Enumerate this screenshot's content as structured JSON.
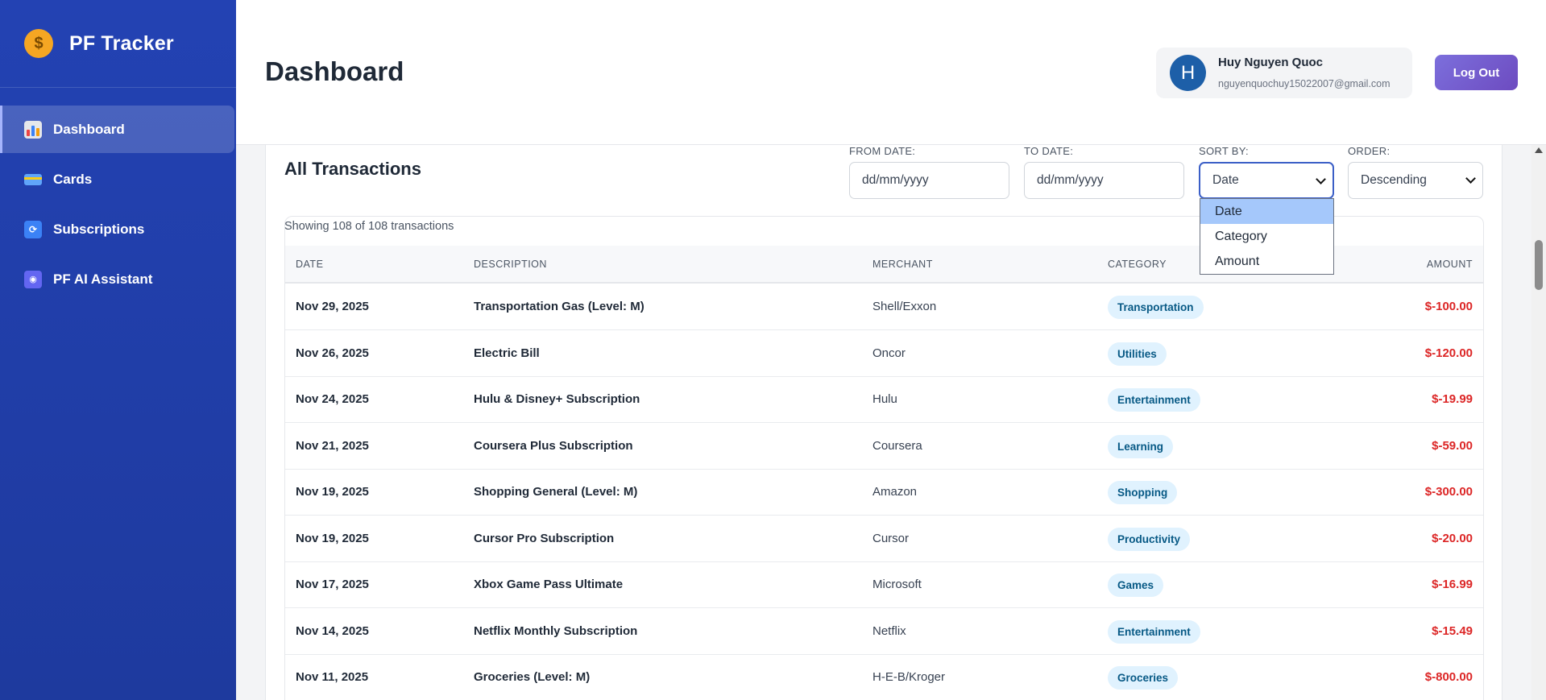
{
  "sidebar": {
    "brand_title": "PF Tracker",
    "items": [
      {
        "label": "Dashboard",
        "icon": "chart-icon",
        "active": true
      },
      {
        "label": "Cards",
        "icon": "credit-card-icon",
        "active": false
      },
      {
        "label": "Subscriptions",
        "icon": "refresh-icon",
        "active": false
      },
      {
        "label": "PF AI Assistant",
        "icon": "robot-icon",
        "active": false
      }
    ]
  },
  "header": {
    "title": "Dashboard",
    "user": {
      "initial": "H",
      "name": "Huy Nguyen Quoc",
      "email": "nguyenquochuy15022007@gmail.com"
    },
    "logout_label": "Log Out"
  },
  "transactions": {
    "title": "All Transactions",
    "filters": {
      "from_label": "FROM DATE:",
      "from_placeholder": "dd/mm/yyyy",
      "to_label": "TO DATE:",
      "to_placeholder": "dd/mm/yyyy",
      "sort_label": "SORT BY:",
      "sort_value": "Date",
      "sort_options": [
        "Date",
        "Category",
        "Amount"
      ],
      "order_label": "ORDER:",
      "order_value": "Descending"
    },
    "showing_text": "Showing 108 of 108 transactions",
    "columns": [
      "DATE",
      "DESCRIPTION",
      "MERCHANT",
      "CATEGORY",
      "AMOUNT"
    ],
    "rows": [
      {
        "date": "Nov 29, 2025",
        "description": "Transportation Gas (Level: M)",
        "merchant": "Shell/Exxon",
        "category": "Transportation",
        "amount": "$-100.00"
      },
      {
        "date": "Nov 26, 2025",
        "description": "Electric Bill",
        "merchant": "Oncor",
        "category": "Utilities",
        "amount": "$-120.00"
      },
      {
        "date": "Nov 24, 2025",
        "description": "Hulu & Disney+ Subscription",
        "merchant": "Hulu",
        "category": "Entertainment",
        "amount": "$-19.99"
      },
      {
        "date": "Nov 21, 2025",
        "description": "Coursera Plus Subscription",
        "merchant": "Coursera",
        "category": "Learning",
        "amount": "$-59.00"
      },
      {
        "date": "Nov 19, 2025",
        "description": "Shopping General (Level: M)",
        "merchant": "Amazon",
        "category": "Shopping",
        "amount": "$-300.00"
      },
      {
        "date": "Nov 19, 2025",
        "description": "Cursor Pro Subscription",
        "merchant": "Cursor",
        "category": "Productivity",
        "amount": "$-20.00"
      },
      {
        "date": "Nov 17, 2025",
        "description": "Xbox Game Pass Ultimate",
        "merchant": "Microsoft",
        "category": "Games",
        "amount": "$-16.99"
      },
      {
        "date": "Nov 14, 2025",
        "description": "Netflix Monthly Subscription",
        "merchant": "Netflix",
        "category": "Entertainment",
        "amount": "$-15.49"
      },
      {
        "date": "Nov 11, 2025",
        "description": "Groceries (Level: M)",
        "merchant": "H-E-B/Kroger",
        "category": "Groceries",
        "amount": "$-800.00"
      }
    ]
  },
  "colors": {
    "sidebar": "#2342b3",
    "accent": "#6d4bc0",
    "negative_amount": "#dc2626",
    "badge_bg": "#e0f2fe"
  }
}
